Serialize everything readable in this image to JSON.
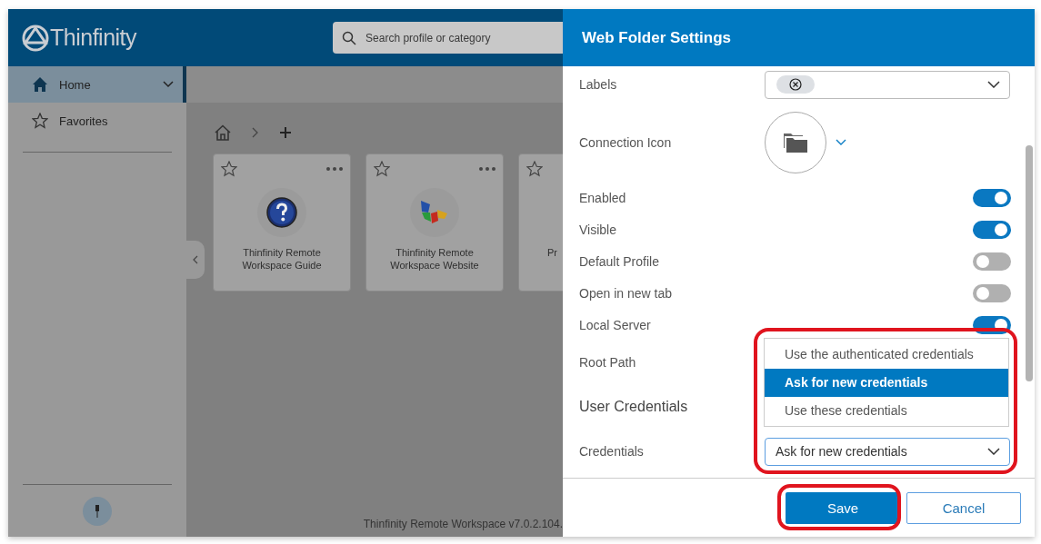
{
  "app": {
    "logo": "Thinfinity",
    "search": {
      "placeholder": "Search profile or category"
    },
    "sidebar": {
      "items": [
        {
          "label": "Home",
          "selected": true,
          "expanded": false
        },
        {
          "label": "Favorites",
          "selected": false
        }
      ]
    },
    "cards": [
      {
        "kind": "help",
        "title": "Thinfinity Remote Workspace Guide"
      },
      {
        "kind": "logo",
        "title": "Thinfinity Remote Workspace Website"
      },
      {
        "kind": "partial",
        "title": "Pr"
      }
    ],
    "footer": "Thinfinity Remote Workspace v7.0.2.104."
  },
  "panel": {
    "title": "Web Folder Settings",
    "rows": [
      {
        "kind": "labels",
        "label": "Labels"
      },
      {
        "kind": "icon",
        "label": "Connection Icon"
      },
      {
        "kind": "toggle",
        "label": "Enabled",
        "on": true
      },
      {
        "kind": "toggle",
        "label": "Visible",
        "on": true
      },
      {
        "kind": "toggle",
        "label": "Default Profile",
        "on": false
      },
      {
        "kind": "toggle",
        "label": "Open in new tab",
        "on": false
      },
      {
        "kind": "toggle",
        "label": "Local Server",
        "on": true
      },
      {
        "kind": "text",
        "label": "Root Path"
      },
      {
        "kind": "heading",
        "label": "User Credentials"
      },
      {
        "kind": "select",
        "label": "Credentials",
        "value": "Ask for new credentials"
      }
    ],
    "dropdown": [
      {
        "label": "Use the authenticated credentials",
        "selected": false
      },
      {
        "label": "Ask for new credentials",
        "selected": true
      },
      {
        "label": "Use these credentials",
        "selected": false
      }
    ],
    "buttons": [
      {
        "kind": "primary",
        "label": "Save"
      },
      {
        "kind": "secondary",
        "label": "Cancel"
      }
    ]
  }
}
